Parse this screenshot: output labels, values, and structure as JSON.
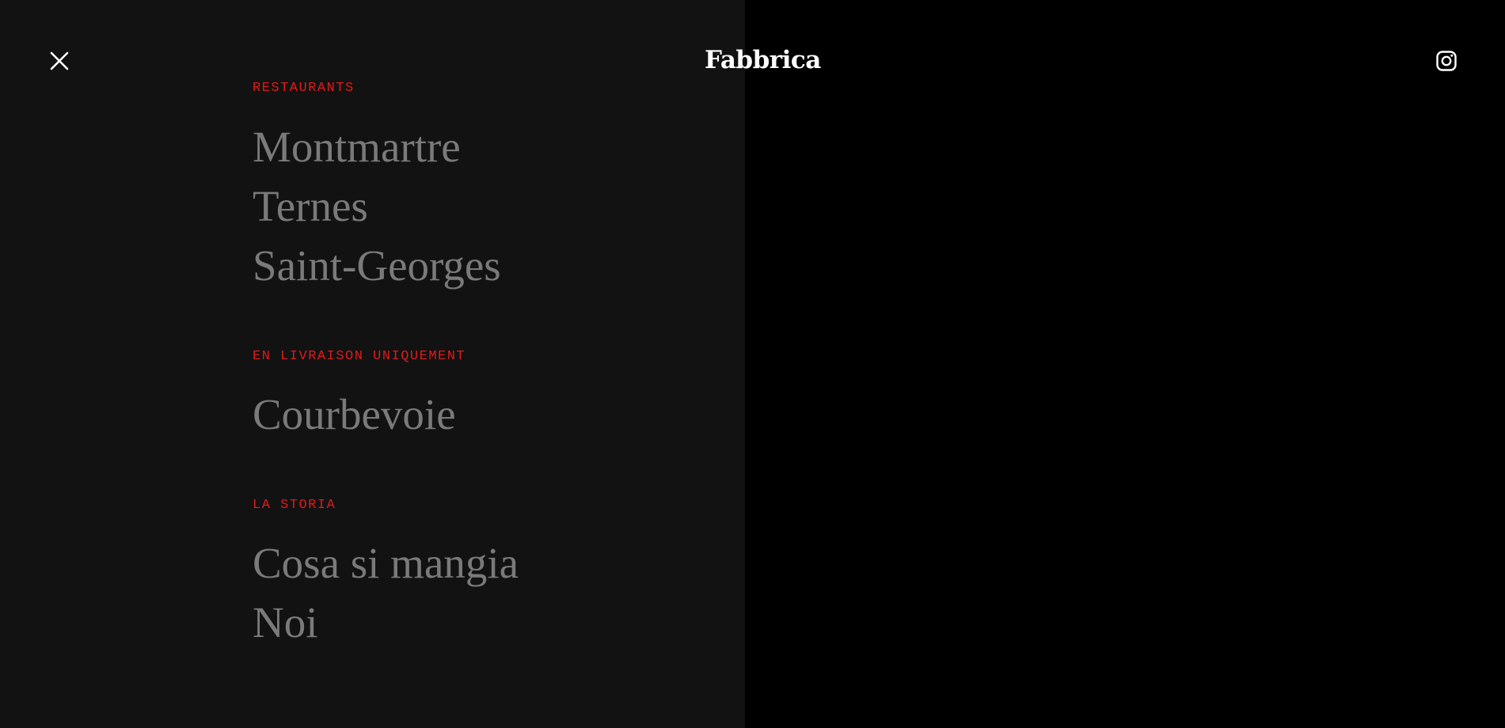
{
  "header": {
    "brand": "Fabbrica",
    "close_icon": "close-icon",
    "instagram_icon": "instagram-icon"
  },
  "menu": {
    "sections": [
      {
        "heading": "RESTAURANTS",
        "links": [
          "Montmartre",
          "Ternes",
          "Saint-Georges"
        ]
      },
      {
        "heading": "EN LIVRAISON UNIQUEMENT",
        "links": [
          "Courbevoie"
        ]
      },
      {
        "heading": "LA STORIA",
        "links": [
          "Cosa si mangia",
          "Noi"
        ]
      }
    ]
  },
  "colors": {
    "menu_background": "#121212",
    "page_background": "#000000",
    "heading_accent": "#e01b1b",
    "link_text": "#7a7a7a",
    "brand_text": "#ffffff"
  }
}
